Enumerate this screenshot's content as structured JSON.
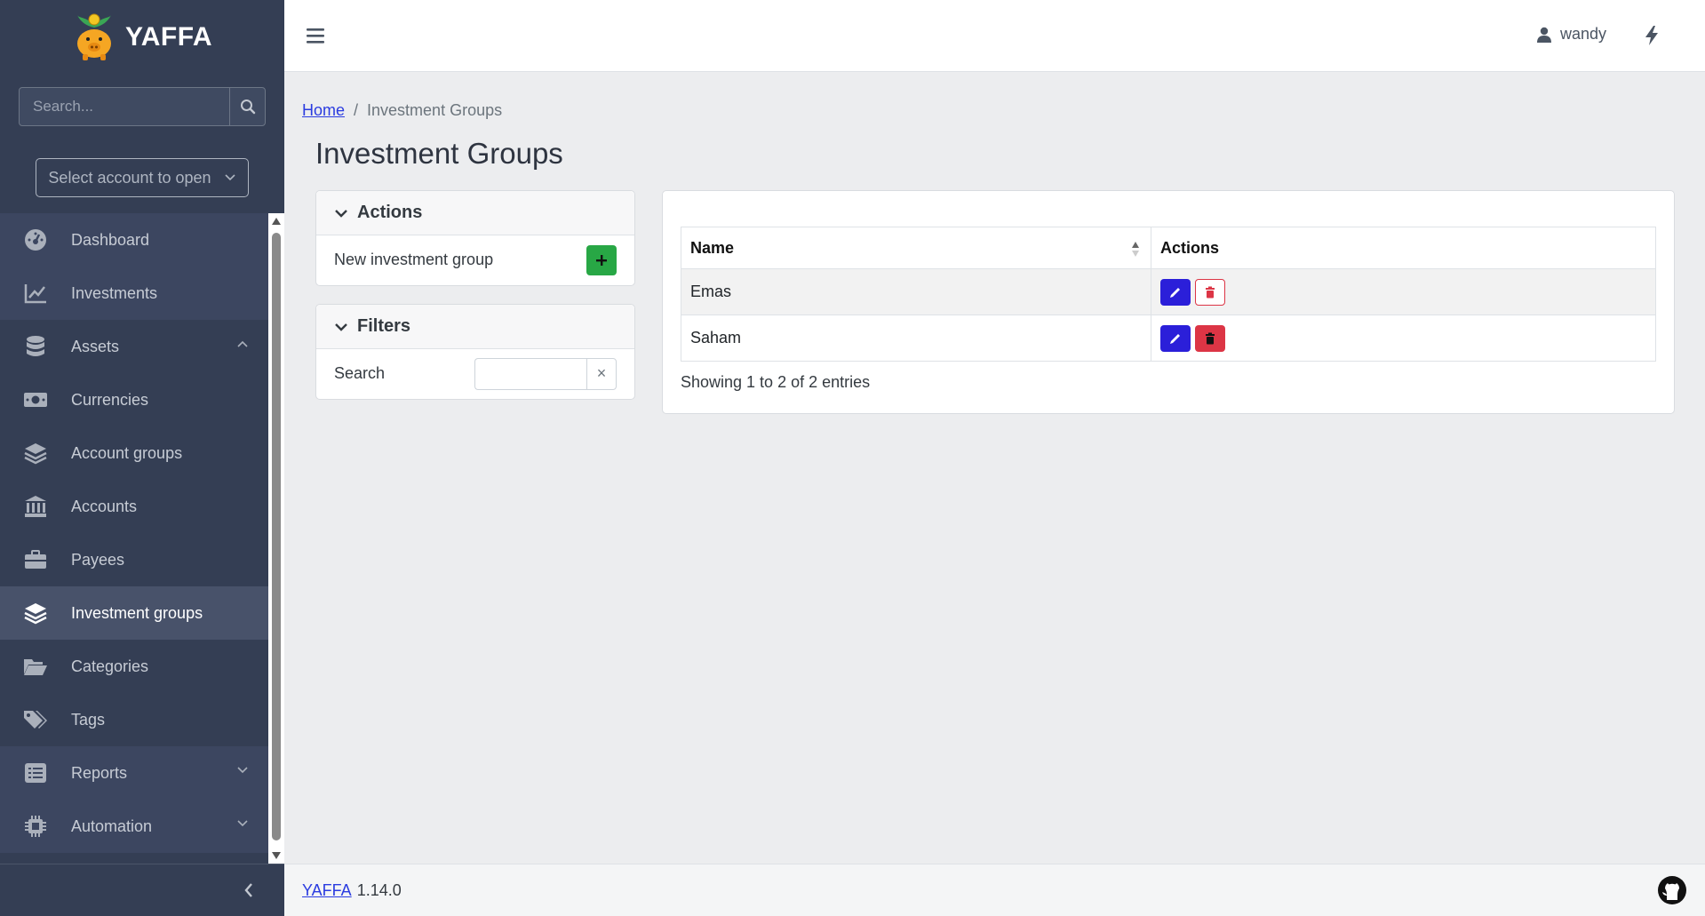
{
  "brand": {
    "name": "YAFFA"
  },
  "sidebar": {
    "search_placeholder": "Search...",
    "select_account": "Select account to open",
    "items": [
      {
        "label": "Dashboard",
        "icon": "tachometer-icon"
      },
      {
        "label": "Investments",
        "icon": "chart-line-icon"
      },
      {
        "label": "Assets",
        "icon": "database-icon",
        "expanded": true
      },
      {
        "label": "Currencies",
        "icon": "money-bill-icon"
      },
      {
        "label": "Account groups",
        "icon": "layer-group-icon"
      },
      {
        "label": "Accounts",
        "icon": "bank-icon"
      },
      {
        "label": "Payees",
        "icon": "briefcase-icon"
      },
      {
        "label": "Investment groups",
        "icon": "layer-group-icon",
        "active": true
      },
      {
        "label": "Categories",
        "icon": "folder-open-icon"
      },
      {
        "label": "Tags",
        "icon": "tags-icon"
      },
      {
        "label": "Reports",
        "icon": "list-icon",
        "expandable": true
      },
      {
        "label": "Automation",
        "icon": "microchip-icon",
        "expandable": true
      }
    ]
  },
  "header": {
    "username": "wandy"
  },
  "breadcrumb": {
    "home": "Home",
    "separator": "/",
    "current": "Investment Groups"
  },
  "page": {
    "title": "Investment Groups"
  },
  "actions_card": {
    "title": "Actions",
    "new_label": "New investment group"
  },
  "filters_card": {
    "title": "Filters",
    "search_label": "Search",
    "clear": "×"
  },
  "table": {
    "columns": [
      "Name",
      "Actions"
    ],
    "rows": [
      {
        "name": "Emas"
      },
      {
        "name": "Saham"
      }
    ],
    "info": "Showing 1 to 2 of 2 entries"
  },
  "footer": {
    "app_link": "YAFFA",
    "version": "1.14.0"
  },
  "colors": {
    "sidebar": "#343e54",
    "edit": "#2b1fd9",
    "delete": "#dc3545",
    "add": "#28a745",
    "link": "#2b3ce0"
  }
}
